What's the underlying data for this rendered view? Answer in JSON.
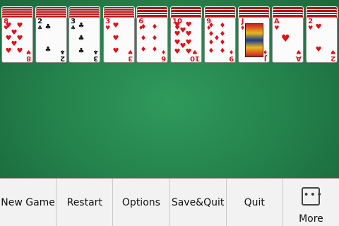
{
  "game": {
    "piles": [
      {
        "rank": "8",
        "suit": "♥",
        "color": "red",
        "pips": 8
      },
      {
        "rank": "2",
        "suit": "♣",
        "color": "black",
        "pips": 2
      },
      {
        "rank": "3",
        "suit": "♣",
        "color": "black",
        "pips": 3
      },
      {
        "rank": "3",
        "suit": "♥",
        "color": "red",
        "pips": 3
      },
      {
        "rank": "6",
        "suit": "♦",
        "color": "red",
        "pips": 6
      },
      {
        "rank": "10",
        "suit": "♥",
        "color": "red",
        "pips": 10
      },
      {
        "rank": "9",
        "suit": "♦",
        "color": "red",
        "pips": 9
      },
      {
        "rank": "J",
        "suit": "♦",
        "color": "red",
        "face": true
      },
      {
        "rank": "A",
        "suit": "♥",
        "color": "red",
        "pips": 1
      },
      {
        "rank": "2",
        "suit": "♥",
        "color": "red",
        "pips": 2
      }
    ],
    "face_down_counts": [
      5,
      5,
      5,
      5,
      4,
      4,
      4,
      4,
      4,
      4
    ]
  },
  "menu": {
    "new_game": "New Game",
    "restart": "Restart",
    "options": "Options",
    "save_quit": "Save&Quit",
    "quit": "Quit",
    "more": "More",
    "more_icon": "more-icon"
  },
  "colors": {
    "felt": "#237f49",
    "card_back": "#b01818",
    "red_suit": "#e0101a",
    "black_suit": "#111111"
  }
}
